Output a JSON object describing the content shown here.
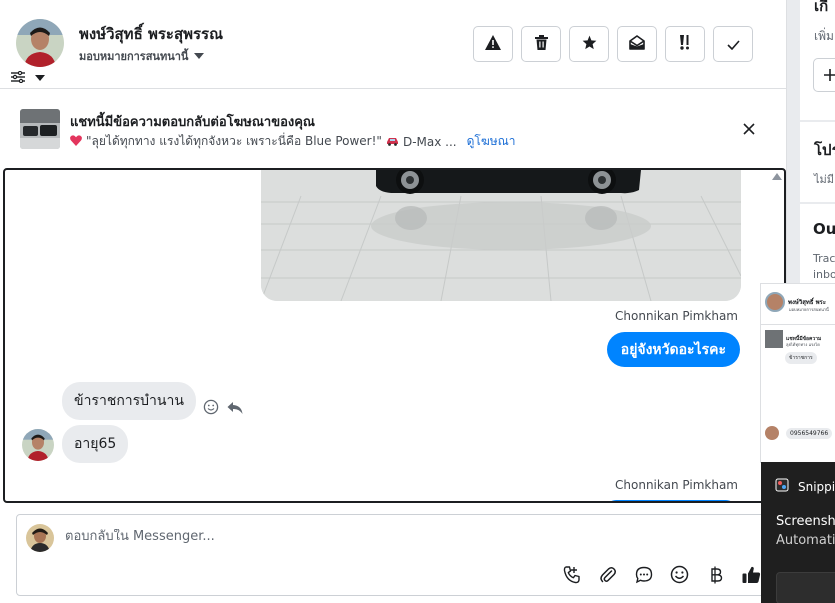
{
  "header": {
    "name": "พงษ์วิสุทธิ์ พระสุพรรณ",
    "assign_label": "มอบหมายการสนทนานี้",
    "actions": [
      "warning-icon",
      "trash-icon",
      "star-icon",
      "mark-unread-icon",
      "follow-up-icon",
      "check-icon"
    ]
  },
  "ad_banner": {
    "title": "แชทนี้มีข้อความตอบกลับต่อโฆษณาของคุณ",
    "text": "\"ลุยได้ทุกทาง แรงได้ทุกจังหวะ เพราะนี่คือ Blue Power!\"",
    "product": "D-Max ...",
    "link": "ดูโฆษณา"
  },
  "conversation": {
    "messages": [
      {
        "sender": "Chonnikan Pimkham",
        "text": "อยู่จังหวัดอะไรคะ",
        "direction": "out"
      },
      {
        "text": "ข้าราชการบำนาน",
        "direction": "in"
      },
      {
        "text": "อายุ65",
        "direction": "in"
      },
      {
        "sender": "Chonnikan Pimkham",
        "direction": "out"
      }
    ]
  },
  "composer": {
    "placeholder": "ตอบกลับใน Messenger...",
    "tools": [
      "phone-icon",
      "attachment-icon",
      "saved-reply-icon",
      "emoji-icon",
      "payment-icon",
      "like-icon"
    ]
  },
  "right_panel": {
    "sec1_title": "เกี",
    "sec1_sub": "เพิ่ม",
    "sec2_title": "โปร",
    "sec2_sub": "ไม่มี",
    "sec3_title": "Ou",
    "sec3_sub1": "Trac",
    "sec3_sub2": "inbo"
  },
  "overlay": {
    "thumb_name": "พงษ์วิสุทธิ์ พระ",
    "thumb_assign": "มอบหมายการสนทนานี้",
    "thumb_ad": "แชทนี้มีข้อความ",
    "thumb_ad_sub": "ลุยได้ทุกทาง แรงได",
    "thumb_msg": "ข้าราชการ",
    "thumb_phone": "0956549766",
    "snip_app": "Snippi",
    "snip_title": "Screensho",
    "snip_sub": "Automatic"
  },
  "colors": {
    "accent": "#0084ff",
    "link": "#1d6fd6",
    "incoming_bubble": "#e9ebee",
    "panel_bg": "#e9ebee",
    "snip_bg": "#1f1f1f"
  }
}
